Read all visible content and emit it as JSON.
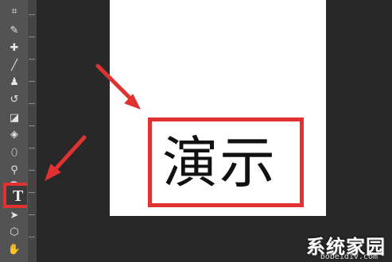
{
  "toolbar": {
    "tools": [
      {
        "name": "crop-tool",
        "icon": "crop-icon"
      },
      {
        "name": "eyedropper-tool",
        "icon": "eyedropper-icon"
      },
      {
        "name": "healing-brush-tool",
        "icon": "bandage-icon"
      },
      {
        "name": "brush-tool",
        "icon": "brush-icon"
      },
      {
        "name": "clone-stamp-tool",
        "icon": "stamp-icon"
      },
      {
        "name": "history-brush-tool",
        "icon": "history-brush-icon"
      },
      {
        "name": "eraser-tool",
        "icon": "eraser-icon"
      },
      {
        "name": "paint-bucket-tool",
        "icon": "bucket-icon"
      },
      {
        "name": "blur-tool",
        "icon": "drop-icon"
      },
      {
        "name": "dodge-tool",
        "icon": "dodge-icon"
      },
      {
        "name": "pen-tool",
        "icon": "pen-icon"
      },
      {
        "name": "type-tool",
        "icon": "type-icon",
        "label": "T"
      },
      {
        "name": "path-selection-tool",
        "icon": "arrow-icon"
      },
      {
        "name": "shape-tool",
        "icon": "hexagon-icon"
      },
      {
        "name": "hand-tool",
        "icon": "hand-icon"
      }
    ],
    "active_tool": "type-tool"
  },
  "canvas": {
    "sample_text": "演示"
  },
  "colors": {
    "highlight": "#e13131",
    "toolbar_bg": "#535353",
    "workspace_bg": "#282828",
    "document_bg": "#ffffff"
  },
  "watermark": {
    "brand": "系统家园",
    "url": "bobeidiv.com"
  }
}
